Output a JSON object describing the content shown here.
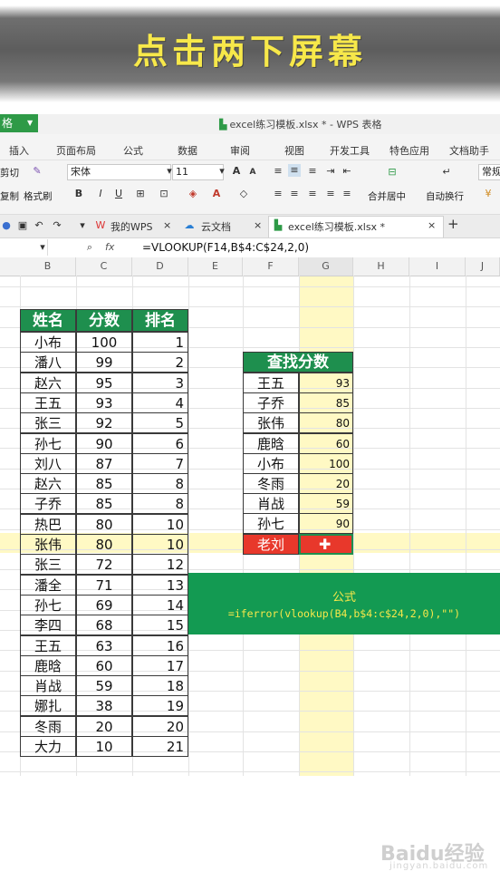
{
  "banner": {
    "text": "点击两下屏幕"
  },
  "app": {
    "tab_label": "格",
    "doc_title": "excel练习模板.xlsx * - WPS 表格"
  },
  "menu": [
    "插入",
    "页面布局",
    "公式",
    "数据",
    "审阅",
    "视图",
    "开发工具",
    "特色应用",
    "文档助手"
  ],
  "toolbar": {
    "cut": "剪切",
    "copy": "复制",
    "format_painter": "格式刷",
    "font_name": "宋体",
    "font_size": "11",
    "merge_center": "合并居中",
    "wrap": "自动换行",
    "number_format": "常规",
    "bold": "B",
    "italic": "I",
    "underline": "U",
    "grow": "A",
    "shrink": "A"
  },
  "tabs": {
    "my_wps": "我的WPS",
    "cloud": "云文档",
    "doc": "excel练习模板.xlsx *",
    "add": "+"
  },
  "formula_bar": {
    "fx": "fx",
    "formula": "=VLOOKUP(F14,B$4:C$24,2,0)"
  },
  "columns": [
    "B",
    "C",
    "D",
    "E",
    "F",
    "G",
    "H",
    "I",
    "J"
  ],
  "main_table": {
    "headers": [
      "姓名",
      "分数",
      "排名"
    ],
    "rows": [
      [
        "小布",
        "100",
        "1"
      ],
      [
        "潘八",
        "99",
        "2"
      ],
      [
        "赵六",
        "95",
        "3"
      ],
      [
        "王五",
        "93",
        "4"
      ],
      [
        "张三",
        "92",
        "5"
      ],
      [
        "孙七",
        "90",
        "6"
      ],
      [
        "刘八",
        "87",
        "7"
      ],
      [
        "赵六",
        "85",
        "8"
      ],
      [
        "子乔",
        "85",
        "8"
      ],
      [
        "热巴",
        "80",
        "10"
      ],
      [
        "张伟",
        "80",
        "10"
      ],
      [
        "张三",
        "72",
        "12"
      ],
      [
        "潘全",
        "71",
        "13"
      ],
      [
        "孙七",
        "69",
        "14"
      ],
      [
        "李四",
        "68",
        "15"
      ],
      [
        "王五",
        "63",
        "16"
      ],
      [
        "鹿晗",
        "60",
        "17"
      ],
      [
        "肖战",
        "59",
        "18"
      ],
      [
        "娜扎",
        "38",
        "19"
      ],
      [
        "冬雨",
        "20",
        "20"
      ],
      [
        "大力",
        "10",
        "21"
      ]
    ]
  },
  "lookup_table": {
    "header": "查找分数",
    "rows": [
      [
        "王五",
        "93"
      ],
      [
        "子乔",
        "85"
      ],
      [
        "张伟",
        "80"
      ],
      [
        "鹿晗",
        "60"
      ],
      [
        "小布",
        "100"
      ],
      [
        "冬雨",
        "20"
      ],
      [
        "肖战",
        "59"
      ],
      [
        "孙七",
        "90"
      ],
      [
        "老刘",
        ""
      ]
    ]
  },
  "formula_note": {
    "title": "公式",
    "code": "=iferror(vlookup(B4,b$4:c$24,2,0),\"\")"
  },
  "watermark": {
    "text": "Baidu经验",
    "sub": "jingyan.baidu.com"
  },
  "colors": {
    "green": "#1e8f4e",
    "yellow": "#f7e84a",
    "red": "#e8382b",
    "highlight": "#fff9c4"
  }
}
